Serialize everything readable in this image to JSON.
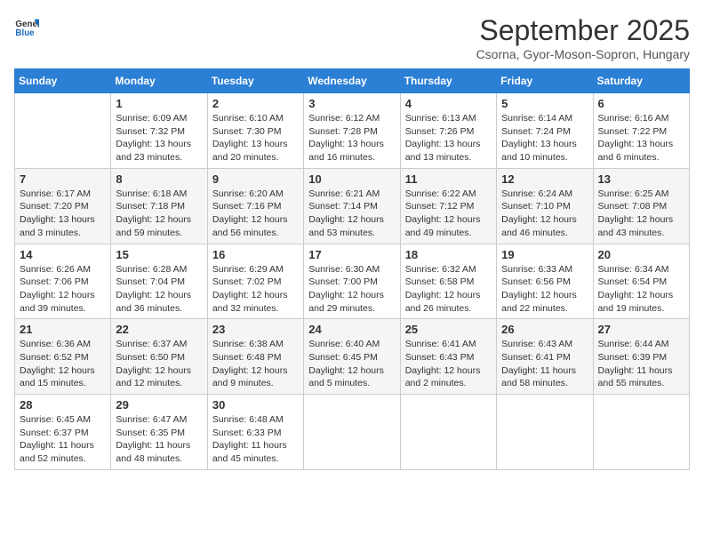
{
  "logo": {
    "line1": "General",
    "line2": "Blue"
  },
  "title": "September 2025",
  "subtitle": "Csorna, Gyor-Moson-Sopron, Hungary",
  "days_of_week": [
    "Sunday",
    "Monday",
    "Tuesday",
    "Wednesday",
    "Thursday",
    "Friday",
    "Saturday"
  ],
  "weeks": [
    [
      {
        "day": "",
        "info": ""
      },
      {
        "day": "1",
        "info": "Sunrise: 6:09 AM\nSunset: 7:32 PM\nDaylight: 13 hours\nand 23 minutes."
      },
      {
        "day": "2",
        "info": "Sunrise: 6:10 AM\nSunset: 7:30 PM\nDaylight: 13 hours\nand 20 minutes."
      },
      {
        "day": "3",
        "info": "Sunrise: 6:12 AM\nSunset: 7:28 PM\nDaylight: 13 hours\nand 16 minutes."
      },
      {
        "day": "4",
        "info": "Sunrise: 6:13 AM\nSunset: 7:26 PM\nDaylight: 13 hours\nand 13 minutes."
      },
      {
        "day": "5",
        "info": "Sunrise: 6:14 AM\nSunset: 7:24 PM\nDaylight: 13 hours\nand 10 minutes."
      },
      {
        "day": "6",
        "info": "Sunrise: 6:16 AM\nSunset: 7:22 PM\nDaylight: 13 hours\nand 6 minutes."
      }
    ],
    [
      {
        "day": "7",
        "info": "Sunrise: 6:17 AM\nSunset: 7:20 PM\nDaylight: 13 hours\nand 3 minutes."
      },
      {
        "day": "8",
        "info": "Sunrise: 6:18 AM\nSunset: 7:18 PM\nDaylight: 12 hours\nand 59 minutes."
      },
      {
        "day": "9",
        "info": "Sunrise: 6:20 AM\nSunset: 7:16 PM\nDaylight: 12 hours\nand 56 minutes."
      },
      {
        "day": "10",
        "info": "Sunrise: 6:21 AM\nSunset: 7:14 PM\nDaylight: 12 hours\nand 53 minutes."
      },
      {
        "day": "11",
        "info": "Sunrise: 6:22 AM\nSunset: 7:12 PM\nDaylight: 12 hours\nand 49 minutes."
      },
      {
        "day": "12",
        "info": "Sunrise: 6:24 AM\nSunset: 7:10 PM\nDaylight: 12 hours\nand 46 minutes."
      },
      {
        "day": "13",
        "info": "Sunrise: 6:25 AM\nSunset: 7:08 PM\nDaylight: 12 hours\nand 43 minutes."
      }
    ],
    [
      {
        "day": "14",
        "info": "Sunrise: 6:26 AM\nSunset: 7:06 PM\nDaylight: 12 hours\nand 39 minutes."
      },
      {
        "day": "15",
        "info": "Sunrise: 6:28 AM\nSunset: 7:04 PM\nDaylight: 12 hours\nand 36 minutes."
      },
      {
        "day": "16",
        "info": "Sunrise: 6:29 AM\nSunset: 7:02 PM\nDaylight: 12 hours\nand 32 minutes."
      },
      {
        "day": "17",
        "info": "Sunrise: 6:30 AM\nSunset: 7:00 PM\nDaylight: 12 hours\nand 29 minutes."
      },
      {
        "day": "18",
        "info": "Sunrise: 6:32 AM\nSunset: 6:58 PM\nDaylight: 12 hours\nand 26 minutes."
      },
      {
        "day": "19",
        "info": "Sunrise: 6:33 AM\nSunset: 6:56 PM\nDaylight: 12 hours\nand 22 minutes."
      },
      {
        "day": "20",
        "info": "Sunrise: 6:34 AM\nSunset: 6:54 PM\nDaylight: 12 hours\nand 19 minutes."
      }
    ],
    [
      {
        "day": "21",
        "info": "Sunrise: 6:36 AM\nSunset: 6:52 PM\nDaylight: 12 hours\nand 15 minutes."
      },
      {
        "day": "22",
        "info": "Sunrise: 6:37 AM\nSunset: 6:50 PM\nDaylight: 12 hours\nand 12 minutes."
      },
      {
        "day": "23",
        "info": "Sunrise: 6:38 AM\nSunset: 6:48 PM\nDaylight: 12 hours\nand 9 minutes."
      },
      {
        "day": "24",
        "info": "Sunrise: 6:40 AM\nSunset: 6:45 PM\nDaylight: 12 hours\nand 5 minutes."
      },
      {
        "day": "25",
        "info": "Sunrise: 6:41 AM\nSunset: 6:43 PM\nDaylight: 12 hours\nand 2 minutes."
      },
      {
        "day": "26",
        "info": "Sunrise: 6:43 AM\nSunset: 6:41 PM\nDaylight: 11 hours\nand 58 minutes."
      },
      {
        "day": "27",
        "info": "Sunrise: 6:44 AM\nSunset: 6:39 PM\nDaylight: 11 hours\nand 55 minutes."
      }
    ],
    [
      {
        "day": "28",
        "info": "Sunrise: 6:45 AM\nSunset: 6:37 PM\nDaylight: 11 hours\nand 52 minutes."
      },
      {
        "day": "29",
        "info": "Sunrise: 6:47 AM\nSunset: 6:35 PM\nDaylight: 11 hours\nand 48 minutes."
      },
      {
        "day": "30",
        "info": "Sunrise: 6:48 AM\nSunset: 6:33 PM\nDaylight: 11 hours\nand 45 minutes."
      },
      {
        "day": "",
        "info": ""
      },
      {
        "day": "",
        "info": ""
      },
      {
        "day": "",
        "info": ""
      },
      {
        "day": "",
        "info": ""
      }
    ]
  ]
}
